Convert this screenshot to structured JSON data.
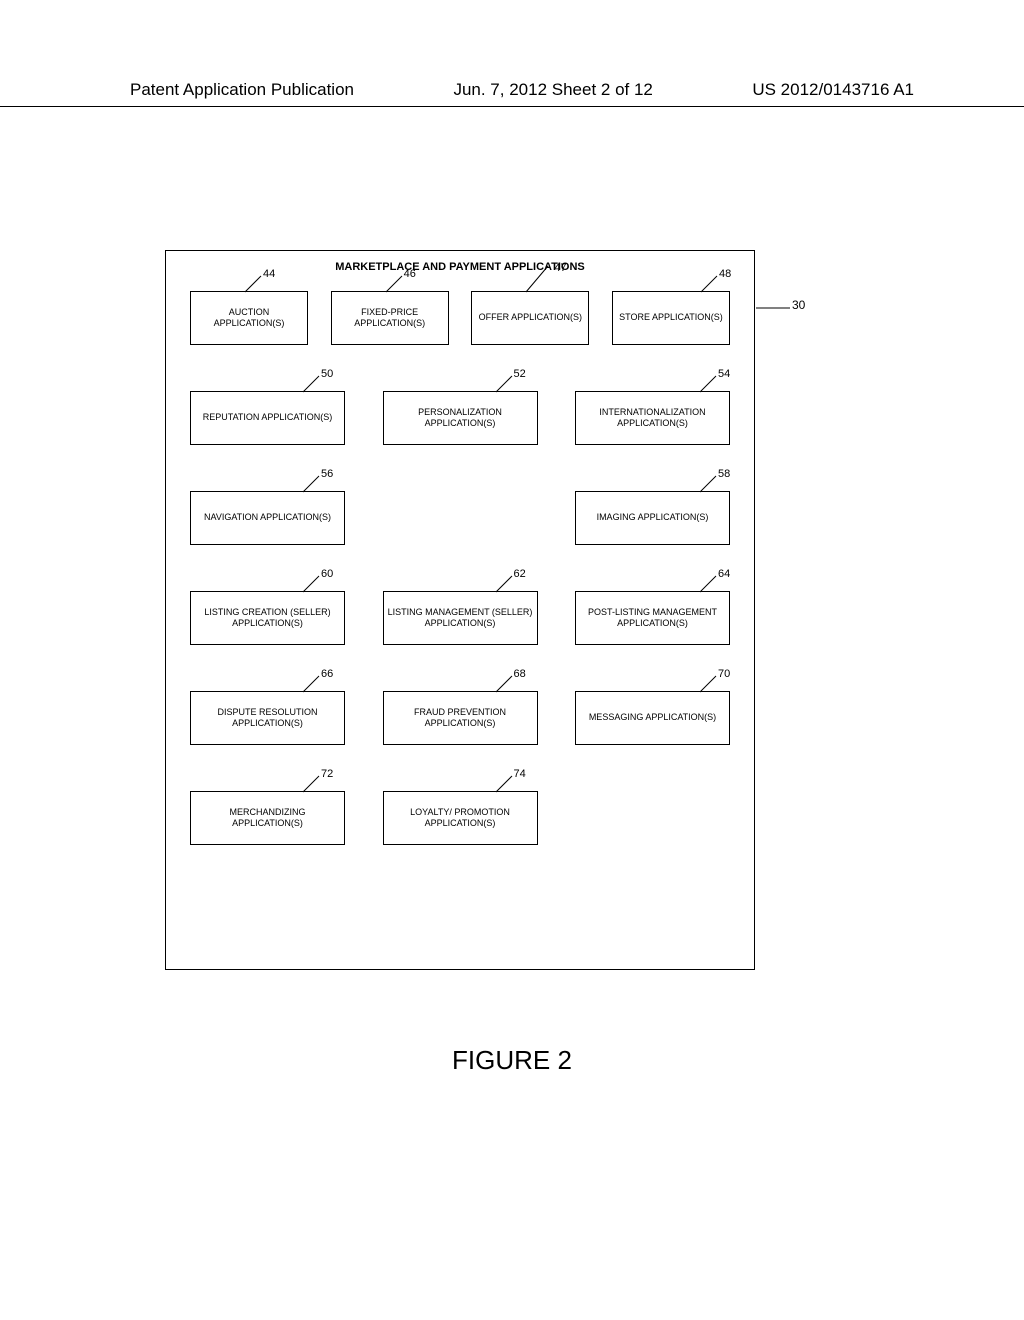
{
  "header": {
    "left": "Patent Application Publication",
    "center": "Jun. 7, 2012   Sheet 2 of 12",
    "right": "US 2012/0143716 A1"
  },
  "diagram": {
    "title": "MARKETPLACE AND PAYMENT APPLICATIONS",
    "outer_ref": "30",
    "rows": [
      {
        "cols": 4,
        "boxes": [
          {
            "ref": "44",
            "label": "AUCTION APPLICATION(S)"
          },
          {
            "ref": "46",
            "label": "FIXED-PRICE APPLICATION(S)"
          },
          {
            "ref": "47",
            "label": "OFFER APPLICATION(S)"
          },
          {
            "ref": "48",
            "label": "STORE APPLICATION(S)"
          }
        ]
      },
      {
        "cols": 3,
        "boxes": [
          {
            "ref": "50",
            "label": "REPUTATION APPLICATION(S)"
          },
          {
            "ref": "52",
            "label": "PERSONALIZATION APPLICATION(S)"
          },
          {
            "ref": "54",
            "label": "INTERNATIONALIZATION APPLICATION(S)"
          }
        ]
      },
      {
        "cols": 3,
        "skip": [
          1
        ],
        "boxes": [
          {
            "ref": "56",
            "label": "NAVIGATION APPLICATION(S)"
          },
          null,
          {
            "ref": "58",
            "label": "IMAGING APPLICATION(S)"
          }
        ]
      },
      {
        "cols": 3,
        "boxes": [
          {
            "ref": "60",
            "label": "LISTING CREATION (SELLER) APPLICATION(S)"
          },
          {
            "ref": "62",
            "label": "LISTING MANAGEMENT (SELLER) APPLICATION(S)"
          },
          {
            "ref": "64",
            "label": "POST-LISTING MANAGEMENT APPLICATION(S)"
          }
        ]
      },
      {
        "cols": 3,
        "boxes": [
          {
            "ref": "66",
            "label": "DISPUTE RESOLUTION APPLICATION(S)"
          },
          {
            "ref": "68",
            "label": "FRAUD PREVENTION APPLICATION(S)"
          },
          {
            "ref": "70",
            "label": "MESSAGING APPLICATION(S)"
          }
        ]
      },
      {
        "cols": 3,
        "skip": [
          2
        ],
        "boxes": [
          {
            "ref": "72",
            "label": "MERCHANDIZING APPLICATION(S)"
          },
          {
            "ref": "74",
            "label": "LOYALTY/ PROMOTION APPLICATION(S)"
          },
          null
        ]
      }
    ]
  },
  "caption": "FIGURE 2"
}
